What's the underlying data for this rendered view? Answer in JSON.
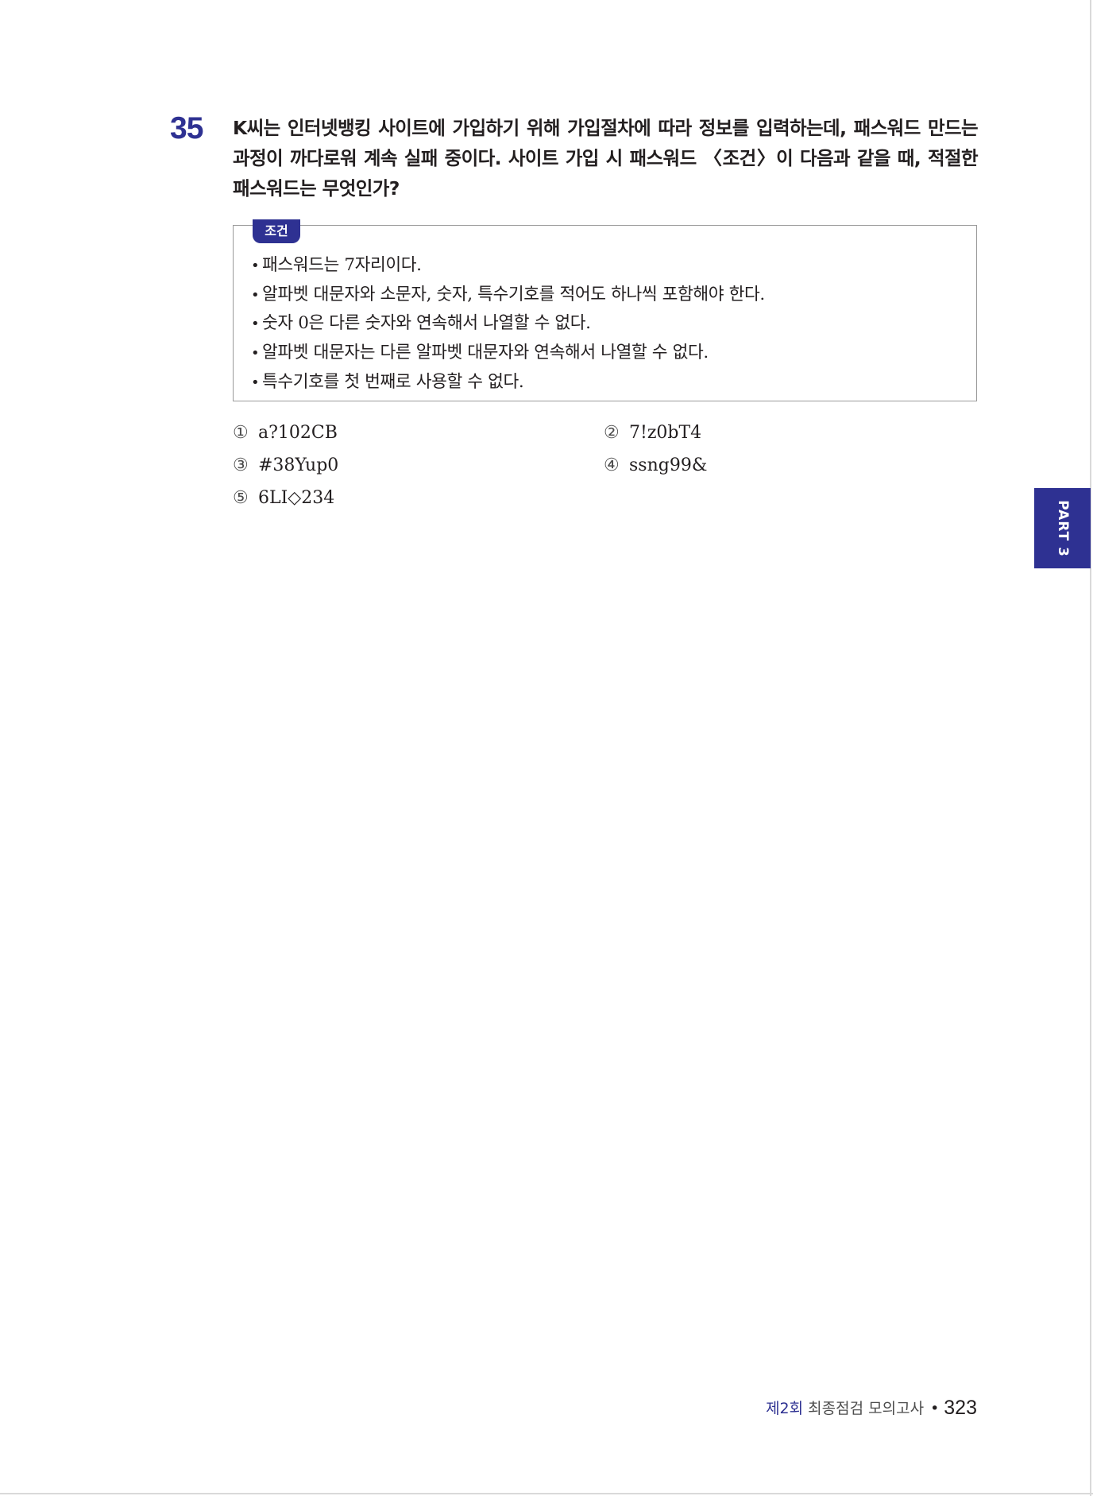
{
  "question": {
    "number": "35",
    "text": "K씨는 인터넷뱅킹 사이트에 가입하기 위해 가입절차에 따라 정보를 입력하는데, 패스워드 만드는 과정이 까다로워 계속 실패 중이다. 사이트 가입 시 패스워드 〈조건〉이 다음과 같을 때, 적절한 패스워드는 무엇인가?"
  },
  "conditions": {
    "label": "조건",
    "bullet": "•",
    "items": [
      "패스워드는 7자리이다.",
      "알파벳 대문자와 소문자, 숫자, 특수기호를 적어도 하나씩 포함해야 한다.",
      "숫자 0은 다른 숫자와 연속해서 나열할 수 없다.",
      "알파벳 대문자는 다른 알파벳 대문자와 연속해서 나열할 수 없다.",
      "특수기호를 첫 번째로 사용할 수 없다."
    ]
  },
  "options": [
    {
      "marker": "①",
      "text": "a?102CB"
    },
    {
      "marker": "②",
      "text": "7!z0bT4"
    },
    {
      "marker": "③",
      "text": "#38Yup0"
    },
    {
      "marker": "④",
      "text": "ssng99&"
    },
    {
      "marker": "⑤",
      "text": "6LI◇234"
    }
  ],
  "side_tab": {
    "label": "PART 3"
  },
  "footer": {
    "round": "제2회",
    "title": "최종점검 모의고사",
    "bullet": "•",
    "page": "323"
  },
  "colors": {
    "accent": "#2e3192",
    "text": "#231f20",
    "box_border": "#9a9a9a"
  }
}
